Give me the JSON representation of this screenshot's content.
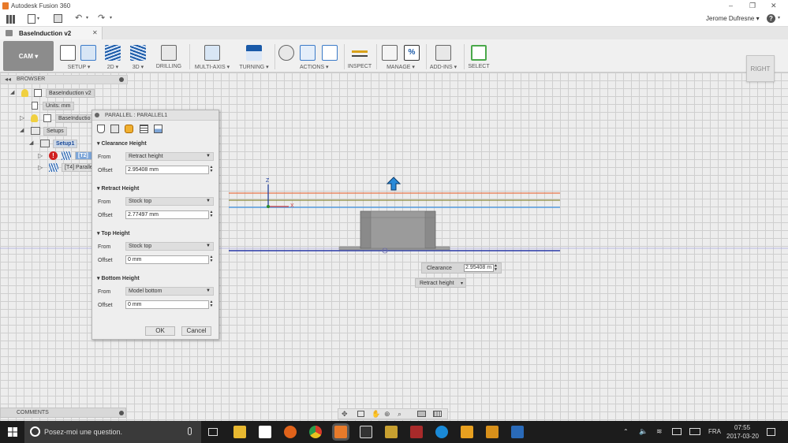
{
  "app": {
    "title": "Autodesk Fusion 360"
  },
  "window_controls": {
    "minimize": "–",
    "restore": "❐",
    "close": "✕"
  },
  "user": {
    "name": "Jerome Dufresne",
    "help": "?"
  },
  "document": {
    "tab_name": "BaseInduction v2",
    "close": "✕"
  },
  "ribbon": {
    "workspace": "CAM ▾",
    "groups": [
      "SETUP ▾",
      "2D ▾",
      "3D ▾",
      "DRILLING",
      "MULTI-AXIS ▾",
      "TURNING ▾",
      "ACTIONS ▾",
      "INSPECT",
      "MANAGE ▾",
      "ADD-INS ▾",
      "SELECT"
    ]
  },
  "browser": {
    "title": "BROWSER",
    "root": "BaseInduction v2",
    "units": "Units: mm",
    "component": "BaseInductio",
    "setups": "Setups",
    "setup1": "Setup1",
    "op_t2": "[T2]",
    "op_t4": "[T4] Paralle"
  },
  "panel": {
    "title": "PARALLEL : PARALLEL1",
    "sections": [
      {
        "title": "Clearance Height",
        "from_label": "From",
        "from": "Retract height",
        "offset_label": "Offset",
        "offset": "2.95408 mm"
      },
      {
        "title": "Retract Height",
        "from_label": "From",
        "from": "Stock top",
        "offset_label": "Offset",
        "offset": "2.77497 mm"
      },
      {
        "title": "Top Height",
        "from_label": "From",
        "from": "Stock top",
        "offset_label": "Offset",
        "offset": "0 mm"
      },
      {
        "title": "Bottom Height",
        "from_label": "From",
        "from": "Model bottom",
        "offset_label": "Offset",
        "offset": "0 mm"
      }
    ],
    "ok": "OK",
    "cancel": "Cancel"
  },
  "canvas": {
    "axis_z": "Z",
    "axis_x": "X",
    "clearance_label": "Clearance",
    "clearance_value": "2.95408 m",
    "retract_dropdown": "Retract height",
    "viewcube": "RIGHT",
    "line_colors": {
      "orange": "#e8744a",
      "olive": "#8a8a3a",
      "blue": "#3a8ee0",
      "dark_blue": "#2a3aa8",
      "guide": "#a0a0e0"
    }
  },
  "comments": {
    "title": "COMMENTS"
  },
  "taskbar": {
    "search": "Posez-moi une question.",
    "lang": "FRA",
    "time": "07:55",
    "date": "2017-03-20"
  }
}
